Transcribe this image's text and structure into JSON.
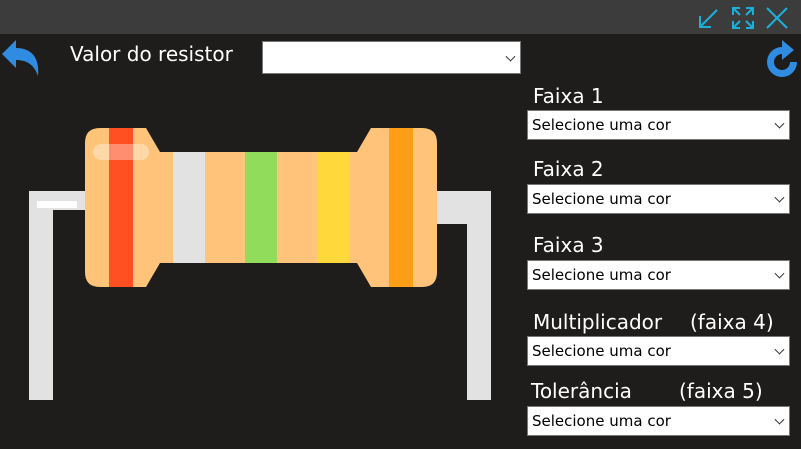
{
  "header": {
    "resistor_value_label": "Valor do resistor",
    "resistor_value_selected": ""
  },
  "controls": {
    "back_icon": "back-arrow-icon",
    "refresh_icon": "refresh-icon",
    "window_icons": [
      "minimize-icon",
      "maximize-icon",
      "close-icon"
    ]
  },
  "bands": [
    {
      "label": "Faixa 1",
      "suffix": "",
      "selected": "Selecione uma cor"
    },
    {
      "label": "Faixa 2",
      "suffix": "",
      "selected": "Selecione uma cor"
    },
    {
      "label": "Faixa 3",
      "suffix": "",
      "selected": "Selecione uma cor"
    },
    {
      "label": "Multiplicador",
      "suffix": "(faixa 4)",
      "selected": "Selecione uma cor"
    },
    {
      "label": "Tolerância",
      "suffix": "(faixa 5)",
      "selected": "Selecione uma cor"
    }
  ],
  "resistor_colors": {
    "body": "#ffc47a",
    "band1": "#ff5022",
    "band2": "#e2e2e2",
    "band3": "#91dc5a",
    "band4": "#ffd93b",
    "band5": "#ff9e17",
    "leads": "#e2e2e2"
  }
}
